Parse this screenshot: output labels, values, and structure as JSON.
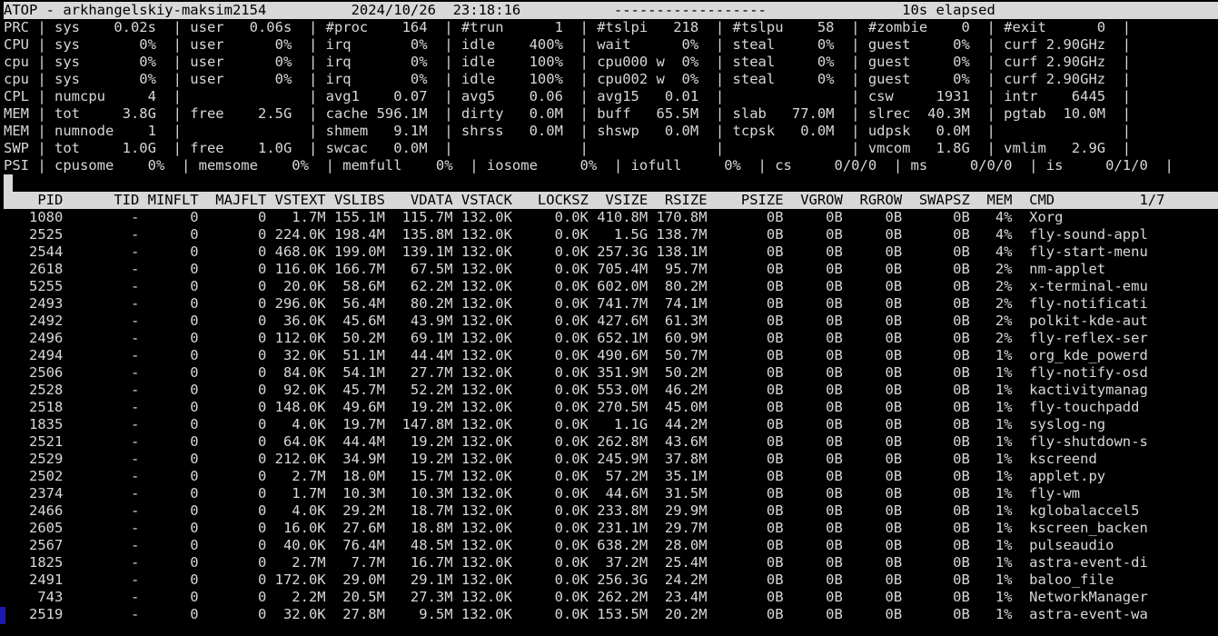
{
  "title_line": "ATOP - arkhangelskiy-maksim2154          2024/10/26  23:18:16           ------------------                10s elapsed",
  "sys_lines": [
    "PRC | sys    0.02s  | user   0.06s  | #proc    164  | #trun      1  | #tslpi   218  | #tslpu    58  | #zombie    0  | #exit      0  |",
    "CPU | sys       0%  | user      0%  | irq       0%  | idle    400%  | wait      0%  | steal     0%  | guest     0%  | curf 2.90GHz  |",
    "cpu | sys       0%  | user      0%  | irq       0%  | idle    100%  | cpu000 w  0%  | steal     0%  | guest     0%  | curf 2.90GHz  |",
    "cpu | sys       0%  | user      0%  | irq       0%  | idle    100%  | cpu002 w  0%  | steal     0%  | guest     0%  | curf 2.90GHz  |",
    "CPL | numcpu     4  |               | avg1    0.07  | avg5    0.06  | avg15   0.01  |               | csw     1931  | intr    6445  |",
    "MEM | tot     3.8G  | free    2.5G  | cache 596.1M  | dirty   0.0M  | buff   65.5M  | slab   77.0M  | slrec  40.3M  | pgtab  10.0M  |",
    "MEM | numnode    1  |               | shmem   9.1M  | shrss   0.0M  | shswp   0.0M  | tcpsk   0.0M  | udpsk   0.0M  |               |",
    "SWP | tot     1.0G  | free    1.0G  | swcac   0.0M  |               |               |               | vmcom   1.8G  | vmlim   2.9G  |",
    "PSI | cpusome    0%  | memsome    0%  | memfull    0%  | iosome     0%  | iofull     0%  | cs     0/0/0  | ms     0/0/0  | is     0/1/0  |"
  ],
  "header_line": "    PID      TID MINFLT  MAJFLT VSTEXT VSLIBS   VDATA VSTACK   LOCKSZ  VSIZE  RSIZE    PSIZE  VGROW  RGROW  SWAPSZ  MEM  CMD          1/7",
  "process_rows": [
    "   1080        -      0       0   1.7M 155.1M  115.7M 132.0K     0.0K 410.8M 170.8M       0B     0B     0B      0B   4%  Xorg",
    "   2525        -      0       0 224.0K 198.4M  135.8M 132.0K     0.0K   1.5G 138.7M       0B     0B     0B      0B   4%  fly-sound-appl",
    "   2544        -      0       0 468.0K 199.0M  139.1M 132.0K     0.0K 257.3G 138.1M       0B     0B     0B      0B   4%  fly-start-menu",
    "   2618        -      0       0 116.0K 166.7M   67.5M 132.0K     0.0K 705.4M  95.7M       0B     0B     0B      0B   2%  nm-applet",
    "   5255        -      0       0  20.0K  58.6M   62.2M 132.0K     0.0K 602.0M  80.2M       0B     0B     0B      0B   2%  x-terminal-emu",
    "   2493        -      0       0 296.0K  56.4M   80.2M 132.0K     0.0K 741.7M  74.1M       0B     0B     0B      0B   2%  fly-notificati",
    "   2492        -      0       0  36.0K  45.6M   43.9M 132.0K     0.0K 427.6M  61.3M       0B     0B     0B      0B   2%  polkit-kde-aut",
    "   2496        -      0       0 112.0K  50.2M   69.1M 132.0K     0.0K 652.1M  60.9M       0B     0B     0B      0B   2%  fly-reflex-ser",
    "   2494        -      0       0  32.0K  51.1M   44.4M 132.0K     0.0K 490.6M  50.7M       0B     0B     0B      0B   1%  org_kde_powerd",
    "   2506        -      0       0  84.0K  54.1M   27.7M 132.0K     0.0K 351.9M  50.2M       0B     0B     0B      0B   1%  fly-notify-osd",
    "   2528        -      0       0  92.0K  45.7M   52.2M 132.0K     0.0K 553.0M  46.2M       0B     0B     0B      0B   1%  kactivitymanag",
    "   2518        -      0       0 148.0K  49.6M   19.2M 132.0K     0.0K 270.5M  45.0M       0B     0B     0B      0B   1%  fly-touchpadd",
    "   1835        -      0       0   4.0K  19.7M  147.8M 132.0K     0.0K   1.1G  44.2M       0B     0B     0B      0B   1%  syslog-ng",
    "   2521        -      0       0  64.0K  44.4M   19.2M 132.0K     0.0K 262.8M  43.6M       0B     0B     0B      0B   1%  fly-shutdown-s",
    "   2529        -      0       0 212.0K  34.9M   19.2M 132.0K     0.0K 245.9M  37.8M       0B     0B     0B      0B   1%  kscreend",
    "   2502        -      0       0   2.7M  18.0M   15.7M 132.0K     0.0K  57.2M  35.1M       0B     0B     0B      0B   1%  applet.py",
    "   2374        -      0       0   1.7M  10.3M   10.3M 132.0K     0.0K  44.6M  31.5M       0B     0B     0B      0B   1%  fly-wm",
    "   2466        -      0       0   4.0K  29.2M   18.7M 132.0K     0.0K 233.8M  29.9M       0B     0B     0B      0B   1%  kglobalaccel5",
    "   2605        -      0       0  16.0K  27.6M   18.8M 132.0K     0.0K 231.1M  29.7M       0B     0B     0B      0B   1%  kscreen_backen",
    "   2567        -      0       0  40.0K  76.4M   48.5M 132.0K     0.0K 638.2M  28.0M       0B     0B     0B      0B   1%  pulseaudio",
    "   1825        -      0       0   2.7M   7.7M   16.7M 132.0K     0.0K  37.2M  25.4M       0B     0B     0B      0B   1%  astra-event-di",
    "   2491        -      0       0 172.0K  29.0M   29.1M 132.0K     0.0K 256.3G  24.2M       0B     0B     0B      0B   1%  baloo_file",
    "    743        -      0       0   2.2M  20.5M   27.3M 132.0K     0.0K 262.2M  23.4M       0B     0B     0B      0B   1%  NetworkManager",
    "   2519        -      0       0  32.0K  27.8M    9.5M 132.0K     0.0K 153.5M  20.2M       0B     0B     0B      0B   1%  astra-event-wa"
  ],
  "colors": {
    "background": "#000000",
    "text": "#d8d8d8",
    "inverse_bg": "#d8d8d8",
    "inverse_text": "#000000",
    "cursor": "#1b1bb0"
  }
}
